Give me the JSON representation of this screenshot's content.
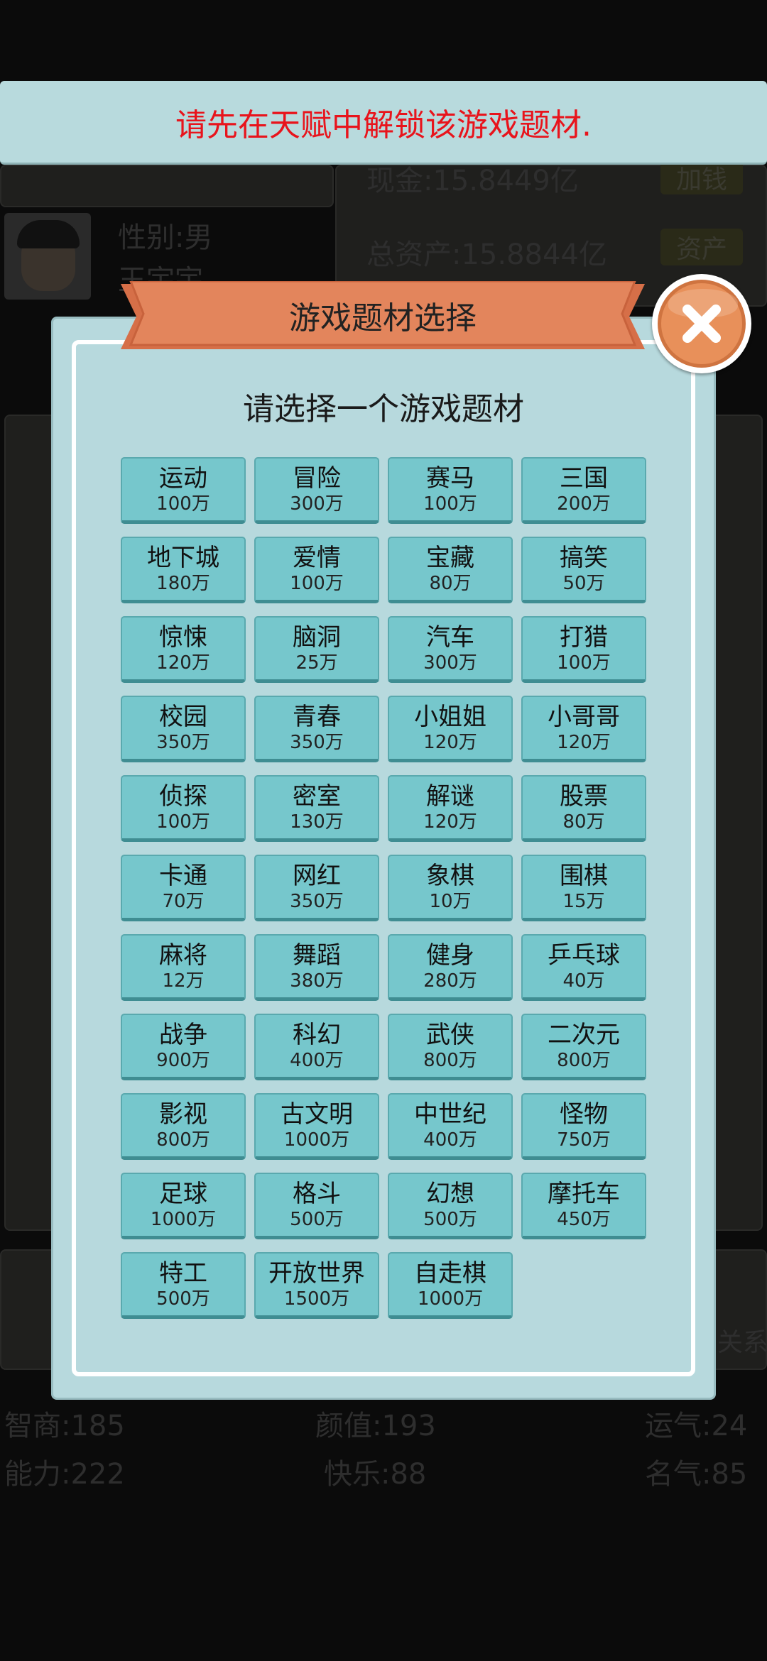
{
  "toast": {
    "message": "请先在天赋中解锁该游戏题材."
  },
  "background": {
    "cash": "现金:15.8449亿",
    "cash_btn": "加钱",
    "gender": "性别:男",
    "name": "王宇宇",
    "total_assets": "总资产:15.8844亿",
    "assets_btn": "资产",
    "stats": [
      {
        "label": "智商:185"
      },
      {
        "label": "颜值:193"
      },
      {
        "label": "运气:24"
      },
      {
        "label": "能力:222"
      },
      {
        "label": "快乐:88"
      },
      {
        "label": "名气:85"
      }
    ],
    "side_text": "关系"
  },
  "modal": {
    "title": "游戏题材选择",
    "subtitle": "请选择一个游戏题材",
    "options": [
      {
        "name": "运动",
        "cost": "100万"
      },
      {
        "name": "冒险",
        "cost": "300万"
      },
      {
        "name": "赛马",
        "cost": "100万"
      },
      {
        "name": "三国",
        "cost": "200万"
      },
      {
        "name": "地下城",
        "cost": "180万"
      },
      {
        "name": "爱情",
        "cost": "100万"
      },
      {
        "name": "宝藏",
        "cost": "80万"
      },
      {
        "name": "搞笑",
        "cost": "50万"
      },
      {
        "name": "惊悚",
        "cost": "120万"
      },
      {
        "name": "脑洞",
        "cost": "25万"
      },
      {
        "name": "汽车",
        "cost": "300万"
      },
      {
        "name": "打猎",
        "cost": "100万"
      },
      {
        "name": "校园",
        "cost": "350万"
      },
      {
        "name": "青春",
        "cost": "350万"
      },
      {
        "name": "小姐姐",
        "cost": "120万"
      },
      {
        "name": "小哥哥",
        "cost": "120万"
      },
      {
        "name": "侦探",
        "cost": "100万"
      },
      {
        "name": "密室",
        "cost": "130万"
      },
      {
        "name": "解谜",
        "cost": "120万"
      },
      {
        "name": "股票",
        "cost": "80万"
      },
      {
        "name": "卡通",
        "cost": "70万"
      },
      {
        "name": "网红",
        "cost": "350万"
      },
      {
        "name": "象棋",
        "cost": "10万"
      },
      {
        "name": "围棋",
        "cost": "15万"
      },
      {
        "name": "麻将",
        "cost": "12万"
      },
      {
        "name": "舞蹈",
        "cost": "380万"
      },
      {
        "name": "健身",
        "cost": "280万"
      },
      {
        "name": "乒乓球",
        "cost": "40万"
      },
      {
        "name": "战争",
        "cost": "900万"
      },
      {
        "name": "科幻",
        "cost": "400万"
      },
      {
        "name": "武侠",
        "cost": "800万"
      },
      {
        "name": "二次元",
        "cost": "800万"
      },
      {
        "name": "影视",
        "cost": "800万"
      },
      {
        "name": "古文明",
        "cost": "1000万"
      },
      {
        "name": "中世纪",
        "cost": "400万"
      },
      {
        "name": "怪物",
        "cost": "750万"
      },
      {
        "name": "足球",
        "cost": "1000万"
      },
      {
        "name": "格斗",
        "cost": "500万"
      },
      {
        "name": "幻想",
        "cost": "500万"
      },
      {
        "name": "摩托车",
        "cost": "450万"
      },
      {
        "name": "特工",
        "cost": "500万"
      },
      {
        "name": "开放世界",
        "cost": "1500万"
      },
      {
        "name": "自走棋",
        "cost": "1000万"
      }
    ]
  },
  "colors": {
    "toast_bg": "#b8dadd",
    "toast_text": "#e8141c",
    "modal_bg": "#b7d9dd",
    "ribbon": "#e0825a",
    "option_bg": "#76c7cc",
    "close_bg": "#e8905a"
  },
  "icons": {
    "close": "close-x-icon"
  }
}
